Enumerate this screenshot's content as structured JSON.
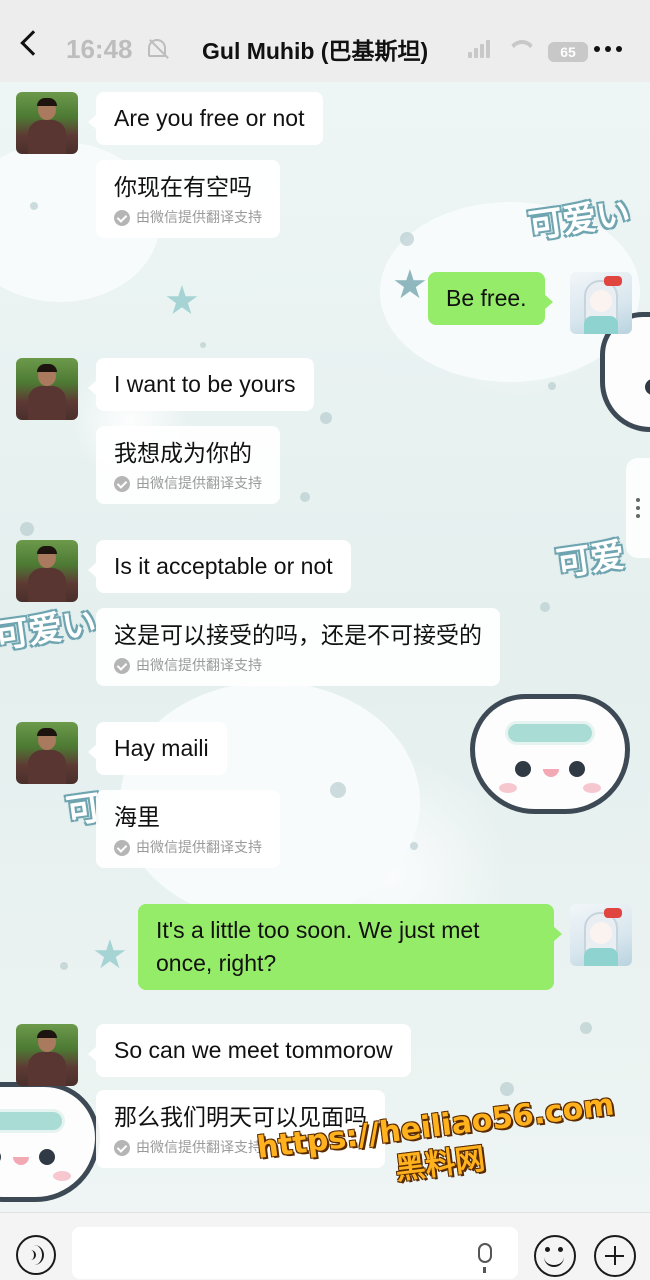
{
  "status_bar": {
    "time": "16:48",
    "battery": "65"
  },
  "header": {
    "title": "Gul Muhib (巴基斯坦)"
  },
  "wallpaper": {
    "decor_text": [
      "可爱い",
      "可爱",
      "可爱い",
      "可"
    ]
  },
  "translation_credit": "由微信提供翻译支持",
  "messages": [
    {
      "sender": "them",
      "text": "Are you free or not",
      "translation": "你现在有空吗"
    },
    {
      "sender": "me",
      "text": "Be free."
    },
    {
      "sender": "them",
      "text": "I want to be yours",
      "translation": "我想成为你的"
    },
    {
      "sender": "them",
      "text": "Is it acceptable or not",
      "translation": "这是可以接受的吗，还是不可接受的"
    },
    {
      "sender": "them",
      "text": "Hay maili",
      "translation": "海里"
    },
    {
      "sender": "me",
      "text": "It's a little too soon. We just met once, right?"
    },
    {
      "sender": "them",
      "text": "So can we meet tommorow",
      "translation": "那么我们明天可以见面吗"
    }
  ],
  "watermark": {
    "url": "https://heiliao56.com",
    "name": "黑料网"
  },
  "colors": {
    "outgoing_bubble": "#95ec69",
    "incoming_bubble": "#ffffff",
    "topbar": "#ededed"
  }
}
